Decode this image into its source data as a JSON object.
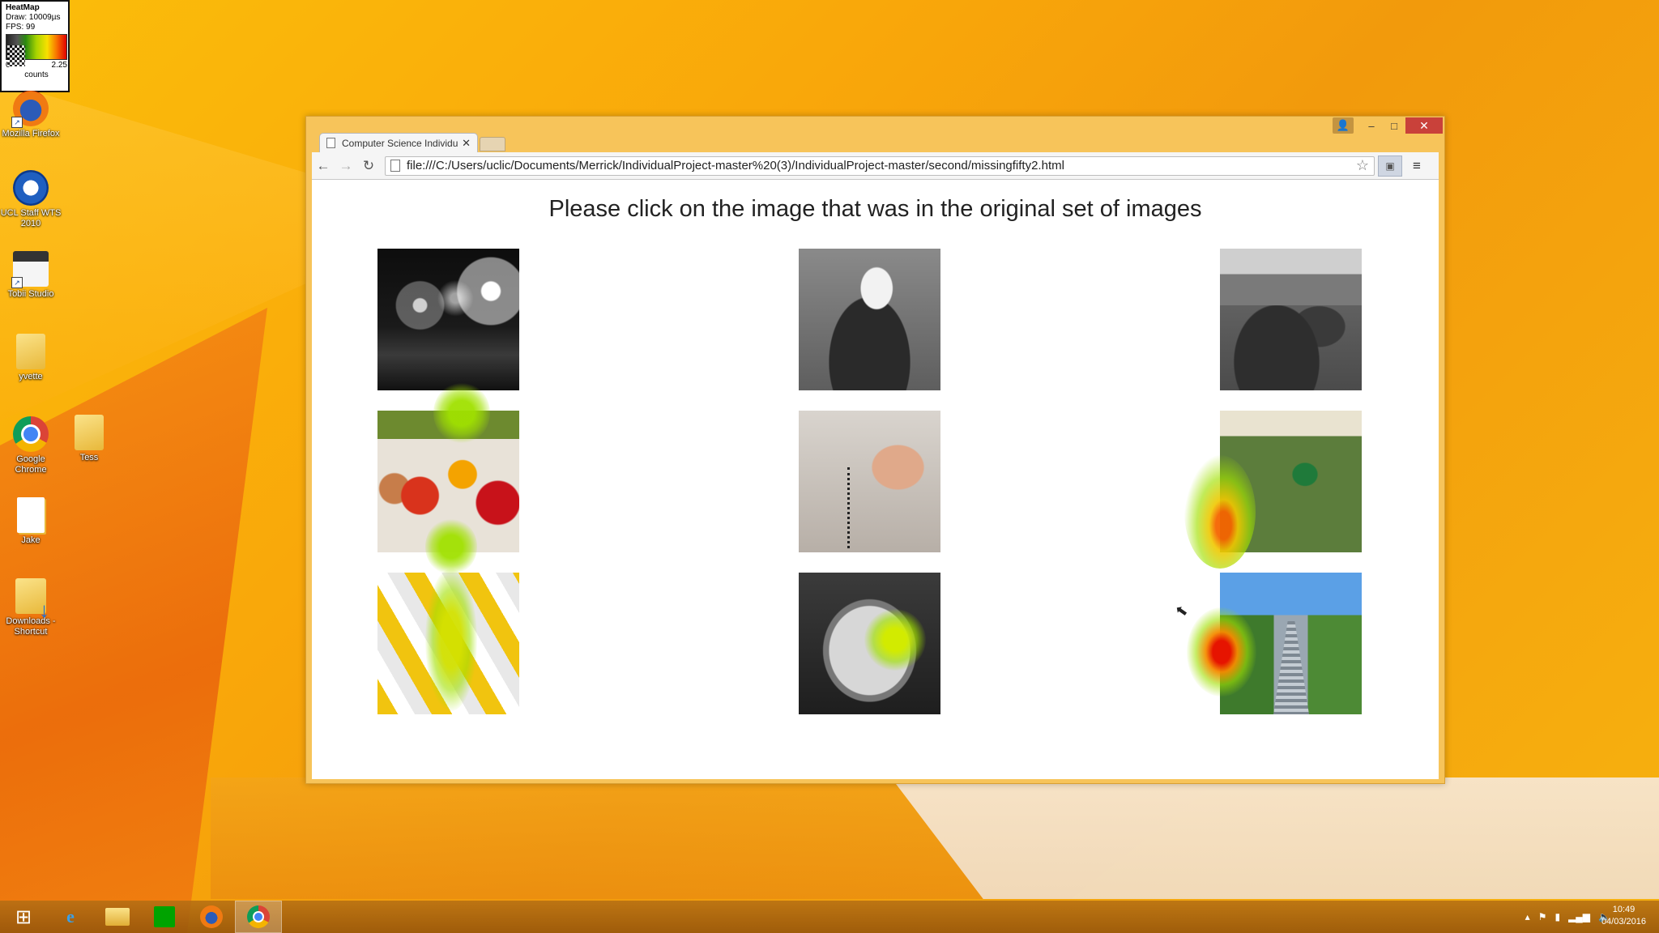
{
  "heatmap_widget": {
    "title": "HeatMap",
    "draw": "Draw: 10009µs",
    "fps": "FPS: 99",
    "range_min": "0",
    "range_max": "2.25",
    "unit": "counts"
  },
  "desktop_icons": [
    {
      "label": "Mozilla Firefox",
      "icon": "firefox-icon"
    },
    {
      "label": "UCL Staff WTS 2010",
      "icon": "remote-desktop-icon"
    },
    {
      "label": "Tobii Studio",
      "icon": "tobii-studio-icon"
    },
    {
      "label": "yvette",
      "icon": "folder-icon"
    },
    {
      "label": "Google Chrome",
      "icon": "chrome-icon"
    },
    {
      "label": "Tess",
      "icon": "folder-icon"
    },
    {
      "label": "Jake",
      "icon": "document-icon"
    },
    {
      "label": "Downloads - Shortcut",
      "icon": "downloads-folder-icon"
    }
  ],
  "browser": {
    "tab_title": "Computer Science Individu",
    "url": "file:///C:/Users/uclic/Documents/Merrick/IndividualProject-master%20(3)/IndividualProject-master/second/missingfifty2.html",
    "window_controls": {
      "minimize": "–",
      "maximize": "□",
      "close": "✕"
    }
  },
  "page": {
    "heading": "Please click on the image that was in the original set of images",
    "images": [
      {
        "name": "fireworks",
        "style": "grayscale"
      },
      {
        "name": "eagle",
        "style": "grayscale"
      },
      {
        "name": "sea-stacks",
        "style": "grayscale"
      },
      {
        "name": "vegetables",
        "style": "color"
      },
      {
        "name": "hand-with-cable",
        "style": "color"
      },
      {
        "name": "boy-football",
        "style": "color"
      },
      {
        "name": "measuring-tape",
        "style": "color"
      },
      {
        "name": "pizza",
        "style": "grayscale"
      },
      {
        "name": "park-stairs",
        "style": "color"
      }
    ]
  },
  "taskbar": {
    "apps": [
      "start",
      "internet-explorer",
      "file-explorer",
      "store",
      "firefox",
      "chrome"
    ],
    "active_app": "chrome",
    "time": "10:49",
    "date": "04/03/2016"
  },
  "colors": {
    "heat_low": "#a6e100",
    "heat_mid": "#f2c400",
    "heat_high": "#e41b00",
    "close_button": "#c9413a"
  }
}
